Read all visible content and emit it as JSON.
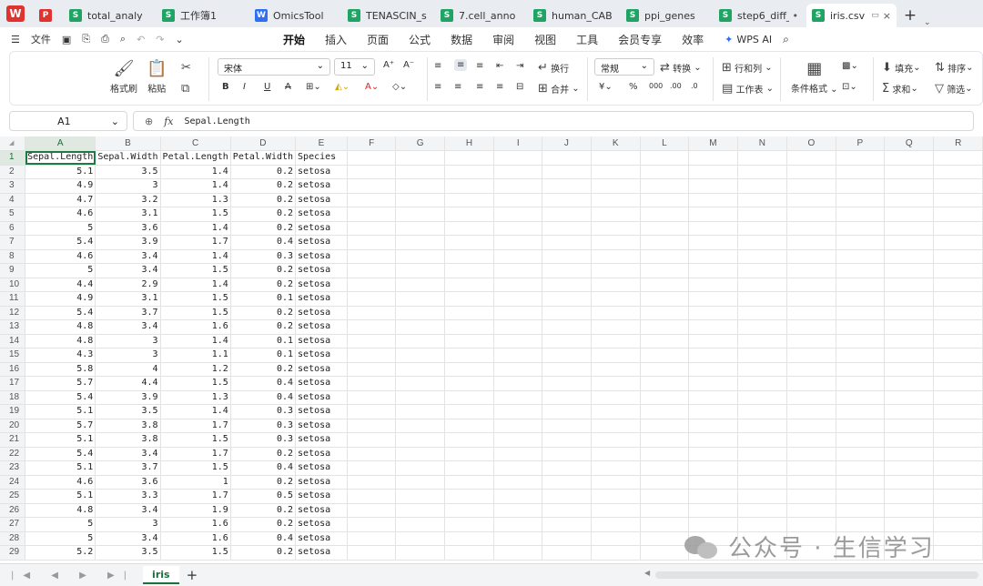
{
  "tabs": [
    {
      "icon": "s",
      "label": "total_analy"
    },
    {
      "icon": "s",
      "label": "工作簿1"
    },
    {
      "icon": "w",
      "label": "OmicsTool"
    },
    {
      "icon": "s",
      "label": "TENASCIN_sig"
    },
    {
      "icon": "s",
      "label": "7.cell_anno"
    },
    {
      "icon": "s",
      "label": "human_CABLI"
    },
    {
      "icon": "s",
      "label": "ppi_genes"
    },
    {
      "icon": "s",
      "label": "step6_diff_"
    },
    {
      "icon": "s",
      "label": "iris.csv"
    }
  ],
  "menu": {
    "file": "文件",
    "items": [
      "开始",
      "插入",
      "页面",
      "公式",
      "数据",
      "审阅",
      "视图",
      "工具",
      "会员专享",
      "效率"
    ],
    "ai": "WPS AI"
  },
  "ribbon": {
    "format_painter": "格式刷",
    "paste": "粘贴",
    "font": "宋体",
    "size": "11",
    "wrap": "换行",
    "merge": "合并",
    "num_format": "常规",
    "convert": "转换",
    "rowcol": "行和列",
    "worksheet": "工作表",
    "cond_format": "条件格式",
    "fill": "填充",
    "sort": "排序",
    "sum": "求和",
    "filter": "筛选"
  },
  "formula_bar": {
    "cell": "A1",
    "fx": "fx",
    "value": "Sepal.Length"
  },
  "columns": [
    "A",
    "B",
    "C",
    "D",
    "E",
    "F",
    "G",
    "H",
    "I",
    "J",
    "K",
    "L",
    "M",
    "N",
    "O",
    "P",
    "Q",
    "R"
  ],
  "rows": [
    [
      "Sepal.Length",
      "Sepal.Width",
      "Petal.Length",
      "Petal.Width",
      "Species"
    ],
    [
      "5.1",
      "3.5",
      "1.4",
      "0.2",
      "setosa"
    ],
    [
      "4.9",
      "3",
      "1.4",
      "0.2",
      "setosa"
    ],
    [
      "4.7",
      "3.2",
      "1.3",
      "0.2",
      "setosa"
    ],
    [
      "4.6",
      "3.1",
      "1.5",
      "0.2",
      "setosa"
    ],
    [
      "5",
      "3.6",
      "1.4",
      "0.2",
      "setosa"
    ],
    [
      "5.4",
      "3.9",
      "1.7",
      "0.4",
      "setosa"
    ],
    [
      "4.6",
      "3.4",
      "1.4",
      "0.3",
      "setosa"
    ],
    [
      "5",
      "3.4",
      "1.5",
      "0.2",
      "setosa"
    ],
    [
      "4.4",
      "2.9",
      "1.4",
      "0.2",
      "setosa"
    ],
    [
      "4.9",
      "3.1",
      "1.5",
      "0.1",
      "setosa"
    ],
    [
      "5.4",
      "3.7",
      "1.5",
      "0.2",
      "setosa"
    ],
    [
      "4.8",
      "3.4",
      "1.6",
      "0.2",
      "setosa"
    ],
    [
      "4.8",
      "3",
      "1.4",
      "0.1",
      "setosa"
    ],
    [
      "4.3",
      "3",
      "1.1",
      "0.1",
      "setosa"
    ],
    [
      "5.8",
      "4",
      "1.2",
      "0.2",
      "setosa"
    ],
    [
      "5.7",
      "4.4",
      "1.5",
      "0.4",
      "setosa"
    ],
    [
      "5.4",
      "3.9",
      "1.3",
      "0.4",
      "setosa"
    ],
    [
      "5.1",
      "3.5",
      "1.4",
      "0.3",
      "setosa"
    ],
    [
      "5.7",
      "3.8",
      "1.7",
      "0.3",
      "setosa"
    ],
    [
      "5.1",
      "3.8",
      "1.5",
      "0.3",
      "setosa"
    ],
    [
      "5.4",
      "3.4",
      "1.7",
      "0.2",
      "setosa"
    ],
    [
      "5.1",
      "3.7",
      "1.5",
      "0.4",
      "setosa"
    ],
    [
      "4.6",
      "3.6",
      "1",
      "0.2",
      "setosa"
    ],
    [
      "5.1",
      "3.3",
      "1.7",
      "0.5",
      "setosa"
    ],
    [
      "4.8",
      "3.4",
      "1.9",
      "0.2",
      "setosa"
    ],
    [
      "5",
      "3",
      "1.6",
      "0.2",
      "setosa"
    ],
    [
      "5",
      "3.4",
      "1.6",
      "0.4",
      "setosa"
    ],
    [
      "5.2",
      "3.5",
      "1.5",
      "0.2",
      "setosa"
    ]
  ],
  "sheets": [
    "iris"
  ],
  "watermark": "公众号 · 生信学习"
}
